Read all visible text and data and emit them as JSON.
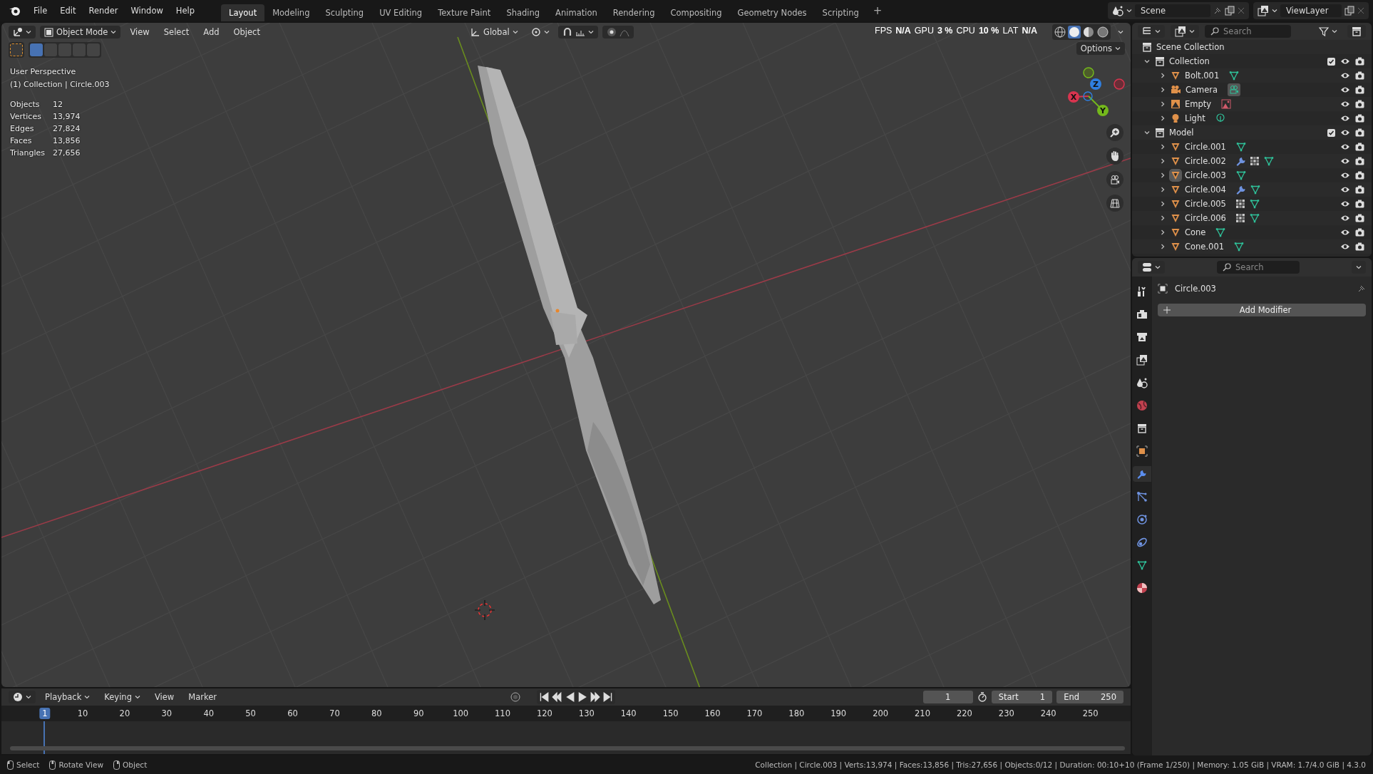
{
  "top_menu": [
    "File",
    "Edit",
    "Render",
    "Window",
    "Help"
  ],
  "workspaces": [
    {
      "label": "Layout",
      "selected": true
    },
    {
      "label": "Modeling",
      "selected": false
    },
    {
      "label": "Sculpting",
      "selected": false
    },
    {
      "label": "UV Editing",
      "selected": false
    },
    {
      "label": "Texture Paint",
      "selected": false
    },
    {
      "label": "Shading",
      "selected": false
    },
    {
      "label": "Animation",
      "selected": false
    },
    {
      "label": "Rendering",
      "selected": false
    },
    {
      "label": "Compositing",
      "selected": false
    },
    {
      "label": "Geometry Nodes",
      "selected": false
    },
    {
      "label": "Scripting",
      "selected": false
    }
  ],
  "add_workspace": "+",
  "scene": "Scene",
  "view_layer": "ViewLayer",
  "viewport": {
    "mode": "Object Mode",
    "menus": [
      "View",
      "Select",
      "Add",
      "Object"
    ],
    "orientation": "Global",
    "performance": [
      {
        "label": "FPS",
        "value": "N/A"
      },
      {
        "label": "GPU",
        "value": "3 %"
      },
      {
        "label": "CPU",
        "value": "10 %"
      },
      {
        "label": "LAT",
        "value": "N/A"
      }
    ],
    "options": "Options",
    "view_name": "User Perspective",
    "active": "(1) Collection | Circle.003",
    "stats": [
      {
        "label": "Objects",
        "value": "12"
      },
      {
        "label": "Vertices",
        "value": "13,974"
      },
      {
        "label": "Edges",
        "value": "27,824"
      },
      {
        "label": "Faces",
        "value": "13,856"
      },
      {
        "label": "Triangles",
        "value": "27,656"
      }
    ],
    "axes": [
      {
        "label": "Z",
        "color": "#2f7fe0"
      },
      {
        "label": "X",
        "color": "#d8344f"
      },
      {
        "label": "Y",
        "color": "#74b81c"
      }
    ]
  },
  "outliner": {
    "search_placeholder": "Search",
    "root": "Scene Collection",
    "collections": [
      {
        "name": "Collection",
        "expanded": true,
        "checked": true,
        "objects": [
          {
            "name": "Bolt.001",
            "kind": "mesh",
            "selected": false,
            "expanded": false,
            "modifiers": false,
            "vertex_groups": false
          },
          {
            "name": "Camera",
            "kind": "camera",
            "selected": false,
            "expanded": false,
            "modifiers": false,
            "vertex_groups": false
          },
          {
            "name": "Empty",
            "kind": "empty",
            "selected": false,
            "expanded": false,
            "modifiers": false,
            "vertex_groups": false
          },
          {
            "name": "Light",
            "kind": "light",
            "selected": false,
            "expanded": false,
            "modifiers": false,
            "vertex_groups": false
          }
        ]
      },
      {
        "name": "Model",
        "expanded": true,
        "checked": true,
        "objects": [
          {
            "name": "Circle.001",
            "kind": "mesh",
            "selected": false,
            "expanded": false,
            "modifiers": false,
            "vertex_groups": false
          },
          {
            "name": "Circle.002",
            "kind": "mesh",
            "selected": false,
            "expanded": false,
            "modifiers": true,
            "vertex_groups": true
          },
          {
            "name": "Circle.003",
            "kind": "mesh",
            "selected": true,
            "expanded": false,
            "modifiers": false,
            "vertex_groups": false
          },
          {
            "name": "Circle.004",
            "kind": "mesh",
            "selected": false,
            "expanded": false,
            "modifiers": true,
            "vertex_groups": false
          },
          {
            "name": "Circle.005",
            "kind": "mesh",
            "selected": false,
            "expanded": false,
            "modifiers": false,
            "vertex_groups": true
          },
          {
            "name": "Circle.006",
            "kind": "mesh",
            "selected": false,
            "expanded": false,
            "modifiers": false,
            "vertex_groups": true
          },
          {
            "name": "Cone",
            "kind": "mesh",
            "selected": false,
            "expanded": false,
            "modifiers": false,
            "vertex_groups": false
          },
          {
            "name": "Cone.001",
            "kind": "mesh",
            "selected": false,
            "expanded": false,
            "modifiers": false,
            "vertex_groups": false
          }
        ]
      }
    ]
  },
  "properties": {
    "search_placeholder": "Search",
    "tabs": [
      {
        "kind": "tool",
        "selected": false
      },
      {
        "kind": "render",
        "selected": false
      },
      {
        "kind": "output",
        "selected": false
      },
      {
        "kind": "view-layer",
        "selected": false
      },
      {
        "kind": "scene",
        "selected": false
      },
      {
        "kind": "world",
        "selected": false
      },
      {
        "kind": "collection",
        "selected": false
      },
      {
        "kind": "object",
        "selected": false
      },
      {
        "kind": "modifiers",
        "selected": true
      },
      {
        "kind": "particles",
        "selected": false
      },
      {
        "kind": "physics",
        "selected": false
      },
      {
        "kind": "constraints",
        "selected": false
      },
      {
        "kind": "data",
        "selected": false
      },
      {
        "kind": "material",
        "selected": false
      }
    ],
    "object_name": "Circle.003",
    "add_button": "Add Modifier"
  },
  "timeline": {
    "menus": [
      "Playback",
      "Keying",
      "View",
      "Marker"
    ],
    "current_frame": "1",
    "start_label": "Start",
    "start": "1",
    "end_label": "End",
    "end": "250",
    "ruler": [
      {
        "label": "1",
        "selected": true
      },
      {
        "label": "10",
        "selected": false
      },
      {
        "label": "20",
        "selected": false
      },
      {
        "label": "30",
        "selected": false
      },
      {
        "label": "40",
        "selected": false
      },
      {
        "label": "50",
        "selected": false
      },
      {
        "label": "60",
        "selected": false
      },
      {
        "label": "70",
        "selected": false
      },
      {
        "label": "80",
        "selected": false
      },
      {
        "label": "90",
        "selected": false
      },
      {
        "label": "100",
        "selected": false
      },
      {
        "label": "110",
        "selected": false
      },
      {
        "label": "120",
        "selected": false
      },
      {
        "label": "130",
        "selected": false
      },
      {
        "label": "140",
        "selected": false
      },
      {
        "label": "150",
        "selected": false
      },
      {
        "label": "160",
        "selected": false
      },
      {
        "label": "170",
        "selected": false
      },
      {
        "label": "180",
        "selected": false
      },
      {
        "label": "190",
        "selected": false
      },
      {
        "label": "200",
        "selected": false
      },
      {
        "label": "210",
        "selected": false
      },
      {
        "label": "220",
        "selected": false
      },
      {
        "label": "230",
        "selected": false
      },
      {
        "label": "240",
        "selected": false
      },
      {
        "label": "250",
        "selected": false
      }
    ]
  },
  "status": {
    "hints": [
      "Select",
      "Rotate View",
      "Object"
    ],
    "info": "Collection | Circle.003 | Verts:13,974 | Faces:13,856 | Tris:27,656 | Objects:0/12 | Duration: 00:10+10 (Frame 1/250) | Memory: 1.05 GiB | VRAM: 1.7/4.0 GiB | 4.3.0"
  }
}
